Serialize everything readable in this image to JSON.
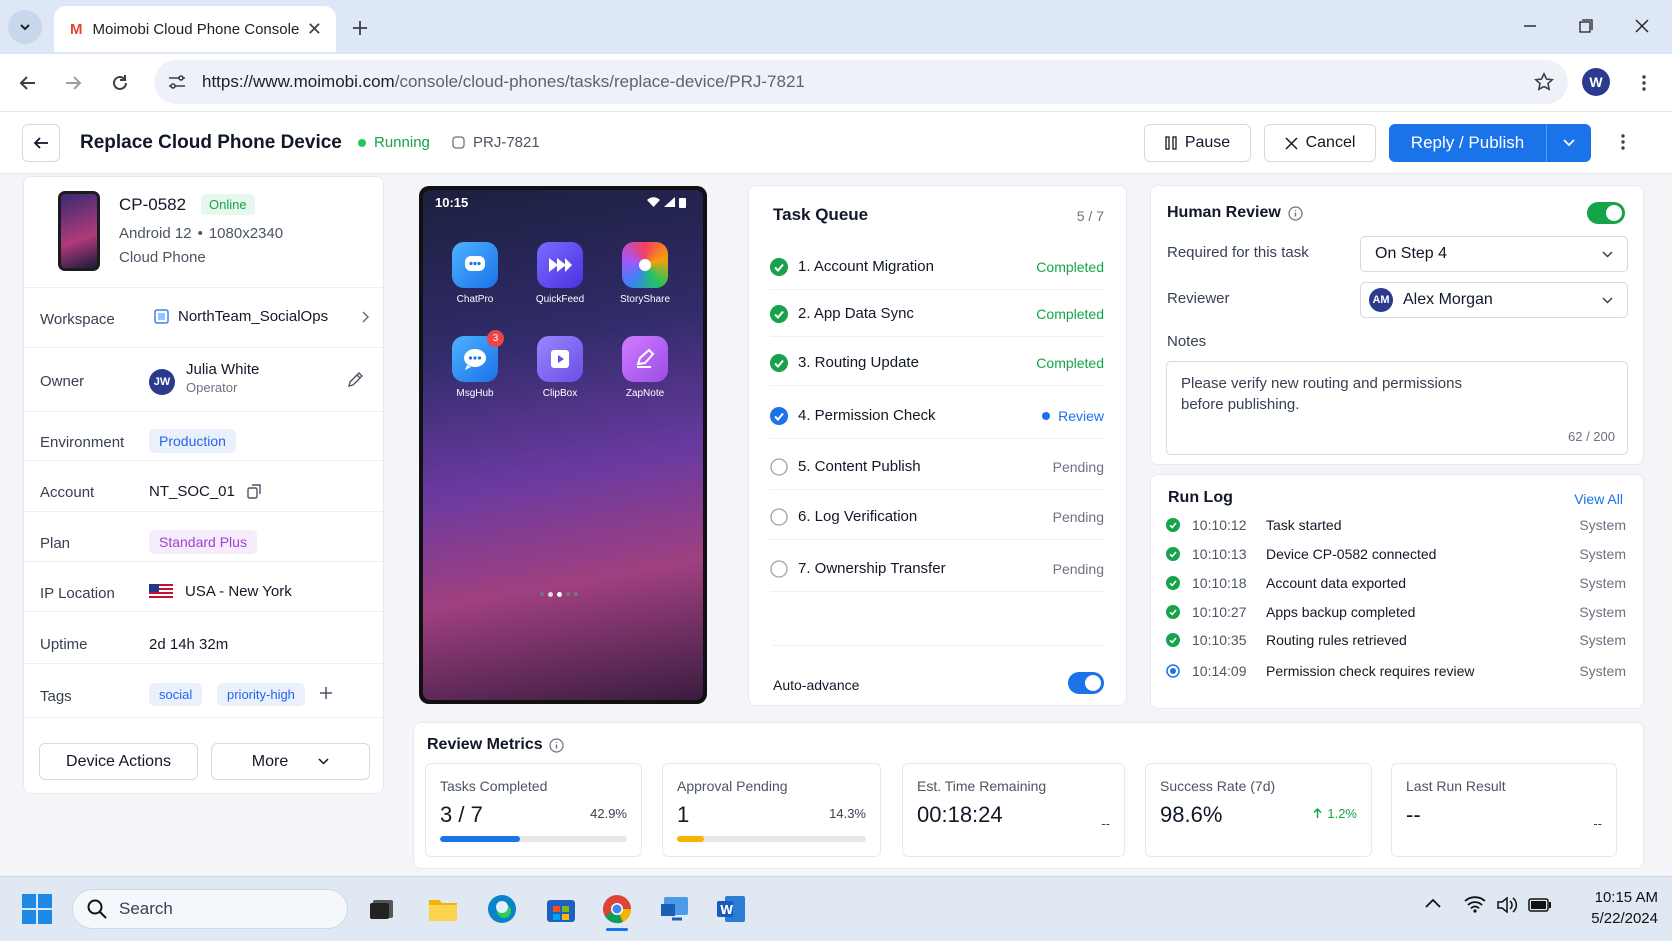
{
  "browser": {
    "tab_title": "Moimobi Cloud Phone Console",
    "url_host": "https://www.moimobi.com",
    "url_path": "/console/cloud-phones/tasks/replace-device/PRJ-7821",
    "profile_initial": "W"
  },
  "header": {
    "title": "Replace Cloud Phone Device",
    "status": "Running",
    "project_id": "PRJ-7821",
    "pause_label": "Pause",
    "cancel_label": "Cancel",
    "publish_label": "Reply / Publish"
  },
  "device": {
    "id": "CP-0582",
    "online_badge": "Online",
    "os": "Android 12",
    "resolution": "1080x2340",
    "type": "Cloud Phone",
    "fields": {
      "workspace_label": "Workspace",
      "workspace_value": "NorthTeam_SocialOps",
      "owner_label": "Owner",
      "owner_initials": "JW",
      "owner_name": "Julia White",
      "owner_role": "Operator",
      "environment_label": "Environment",
      "environment_value": "Production",
      "account_label": "Account",
      "account_value": "NT_SOC_01",
      "plan_label": "Plan",
      "plan_value": "Standard Plus",
      "ip_label": "IP Location",
      "ip_value": "USA - New York",
      "uptime_label": "Uptime",
      "uptime_value": "2d 14h 32m",
      "tags_label": "Tags",
      "tags": [
        "social",
        "priority-high"
      ]
    },
    "actions_label": "Device Actions",
    "more_label": "More"
  },
  "phone": {
    "time": "10:15",
    "apps": [
      {
        "name": "ChatPro",
        "color": "#2f8ff0"
      },
      {
        "name": "QuickFeed",
        "color": "#5b4ef0"
      },
      {
        "name": "StoryShare",
        "color": "#ec4899"
      },
      {
        "name": "MsgHub",
        "color": "#2f8ff0",
        "badge": "3"
      },
      {
        "name": "ClipBox",
        "color": "#7c5cf0"
      },
      {
        "name": "ZapNote",
        "color": "#b35cf0"
      }
    ]
  },
  "task_queue": {
    "title": "Task Queue",
    "progress": "5 / 7",
    "tasks": [
      {
        "label": "1. Account Migration",
        "status": "Completed"
      },
      {
        "label": "2. App Data Sync",
        "status": "Completed"
      },
      {
        "label": "3. Routing Update",
        "status": "Completed"
      },
      {
        "label": "4. Permission Check",
        "status": "Review"
      },
      {
        "label": "5. Content Publish",
        "status": "Pending"
      },
      {
        "label": "6. Log Verification",
        "status": "Pending"
      },
      {
        "label": "7. Ownership Transfer",
        "status": "Pending"
      }
    ],
    "auto_advance_label": "Auto-advance"
  },
  "human_review": {
    "title": "Human Review",
    "required_label": "Required for this task",
    "required_value": "On Step 4",
    "reviewer_label": "Reviewer",
    "reviewer_initials": "AM",
    "reviewer_name": "Alex Morgan",
    "notes_label": "Notes",
    "notes_text": "Please verify new routing and permissions before publishing.",
    "notes_count": "62 / 200"
  },
  "run_log": {
    "title": "Run Log",
    "view_all": "View All",
    "entries": [
      {
        "time": "10:10:12",
        "msg": "Task started",
        "src": "System"
      },
      {
        "time": "10:10:13",
        "msg": "Device CP-0582 connected",
        "src": "System"
      },
      {
        "time": "10:10:18",
        "msg": "Account data exported",
        "src": "System"
      },
      {
        "time": "10:10:27",
        "msg": "Apps backup completed",
        "src": "System"
      },
      {
        "time": "10:10:35",
        "msg": "Routing rules retrieved",
        "src": "System"
      },
      {
        "time": "10:14:09",
        "msg": "Permission check requires review",
        "src": "System"
      }
    ]
  },
  "metrics": {
    "title": "Review Metrics",
    "items": [
      {
        "label": "Tasks Completed",
        "value": "3 / 7",
        "extra": "42.9%",
        "progress": 0.429
      },
      {
        "label": "Approval Pending",
        "value": "1",
        "extra": "14.3%",
        "progress": 0.143
      },
      {
        "label": "Est. Time Remaining",
        "value": "00:18:24",
        "extra": "--"
      },
      {
        "label": "Success Rate (7d)",
        "value": "98.6%",
        "extra": "1.2%"
      },
      {
        "label": "Last Run Result",
        "value": "--",
        "extra": "--"
      }
    ]
  },
  "taskbar": {
    "search_placeholder": "Search",
    "time": "10:15 AM",
    "date": "5/22/2024"
  },
  "colors": {
    "primary": "#1a73e8",
    "success": "#16a34a",
    "running": "#22c55e"
  }
}
